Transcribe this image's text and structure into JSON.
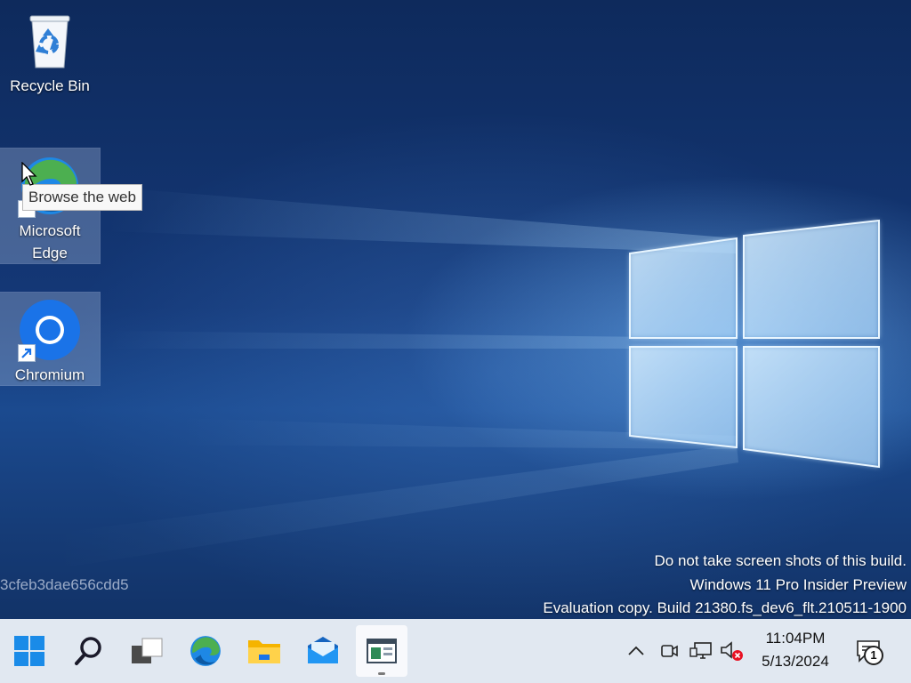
{
  "desktop": {
    "icons": [
      {
        "label": "Recycle Bin",
        "icon": "recycle-bin-icon"
      },
      {
        "label": "Microsoft\nEdge",
        "label_line1": "Microsoft",
        "label_line2": "Edge",
        "icon": "edge-icon"
      },
      {
        "label": "Chromium",
        "icon": "chromium-icon"
      }
    ],
    "tooltip": "Browse the web",
    "build_id": "3cfeb3dae656cdd5",
    "watermark": {
      "line1": "Do not take screen shots of this build.",
      "line2": "Windows 11 Pro Insider Preview",
      "line3": "Evaluation copy. Build 21380.fs_dev6_flt.210511-1900"
    }
  },
  "taskbar": {
    "buttons": [
      {
        "icon": "windows-start-icon"
      },
      {
        "icon": "search-icon"
      },
      {
        "icon": "task-view-icon"
      },
      {
        "icon": "edge-icon"
      },
      {
        "icon": "file-explorer-icon"
      },
      {
        "icon": "mail-icon"
      },
      {
        "icon": "app-window-icon",
        "active": true
      }
    ],
    "tray": {
      "icons": [
        "chevron-up-icon",
        "meet-now-icon",
        "network-icon",
        "volume-muted-icon"
      ],
      "time": "11:04PM",
      "date": "5/13/2024",
      "notification_count": "1"
    }
  },
  "colors": {
    "wallpaper": "#143877",
    "taskbar": "#e8eef6",
    "edge_blue": "#1e88e5",
    "edge_green": "#4caf50",
    "chromium_blue": "#1a73e8",
    "muted_red": "#e81123"
  }
}
